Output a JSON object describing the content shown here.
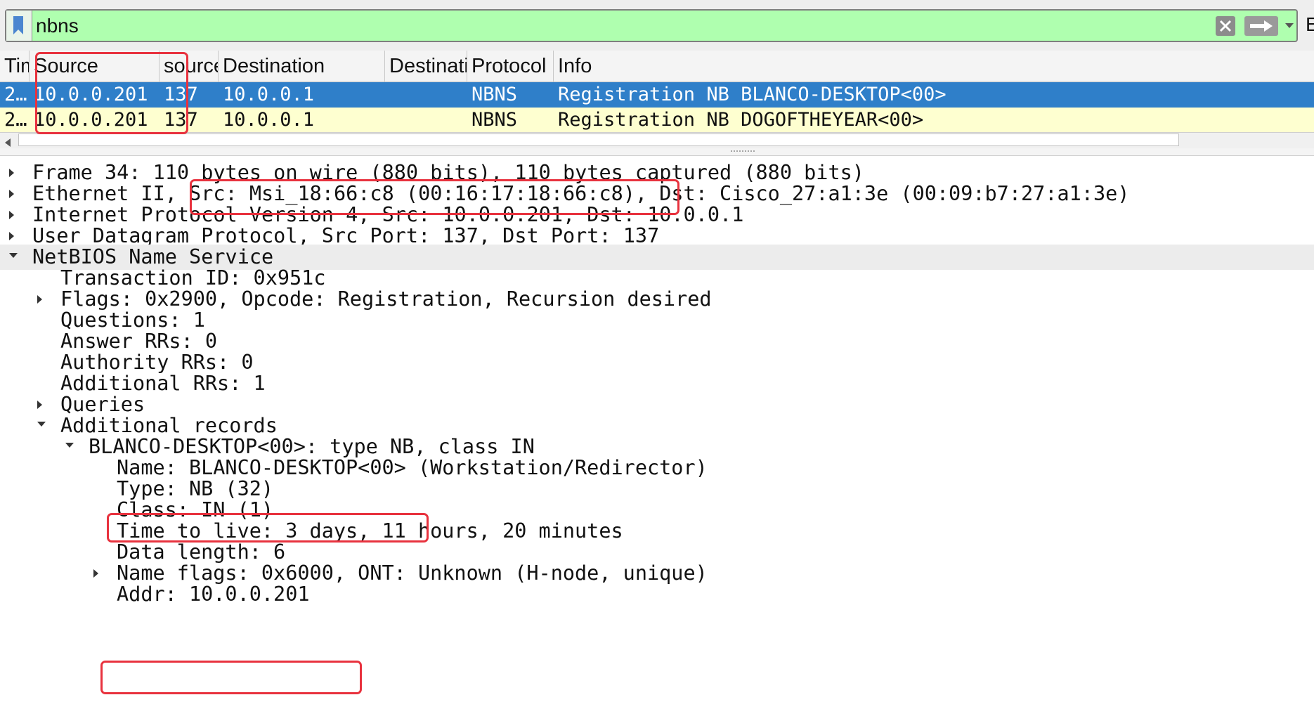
{
  "filter": {
    "value": "nbns",
    "expression_button_label": "E"
  },
  "packet_list": {
    "columns": [
      "Tim",
      "Source",
      "source",
      "Destination",
      "Destinatic",
      "Protocol",
      "Info"
    ],
    "rows": [
      {
        "time": "2…",
        "source": "10.0.0.201",
        "src_port": "137",
        "destination": "10.0.0.1",
        "dst_port": "",
        "protocol": "NBNS",
        "info": "Registration NB BLANCO-DESKTOP<00>",
        "selected": true
      },
      {
        "time": "2…",
        "source": "10.0.0.201",
        "src_port": "137",
        "destination": "10.0.0.1",
        "dst_port": "",
        "protocol": "NBNS",
        "info": "Registration NB DOGOFTHEYEAR<00>",
        "selected": false
      }
    ]
  },
  "details": {
    "frame": "Frame 34: 110 bytes on wire (880 bits), 110 bytes captured (880 bits)",
    "ethernet": "Ethernet II, Src: Msi_18:66:c8 (00:16:17:18:66:c8), Dst: Cisco_27:a1:3e (00:09:b7:27:a1:3e)",
    "ip": "Internet Protocol Version 4, Src: 10.0.0.201, Dst: 10.0.0.1",
    "udp": "User Datagram Protocol, Src Port: 137, Dst Port: 137",
    "nbns": "NetBIOS Name Service",
    "transaction_id": "Transaction ID: 0x951c",
    "flags": "Flags: 0x2900, Opcode: Registration, Recursion desired",
    "questions": "Questions: 1",
    "answer_rrs": "Answer RRs: 0",
    "authority_rrs": "Authority RRs: 0",
    "additional_rrs": "Additional RRs: 1",
    "queries": "Queries",
    "additional_records": "Additional records",
    "record": "BLANCO-DESKTOP<00>: type NB, class IN",
    "name": "Name: BLANCO-DESKTOP<00> (Workstation/Redirector)",
    "type": "Type: NB (32)",
    "class": "Class: IN (1)",
    "ttl": "Time to live: 3 days, 11 hours, 20 minutes",
    "data_length": "Data length: 6",
    "name_flags": "Name flags: 0x6000, ONT: Unknown (H-node, unique)",
    "addr": "Addr: 10.0.0.201"
  },
  "colors": {
    "filter_valid": "#afffaf",
    "selected_row": "#2f7fc9",
    "alt_row": "#feffd0",
    "annotation": "#e8323e"
  },
  "icons": [
    "bookmark-icon",
    "clear-icon",
    "apply-arrow-icon",
    "chevron-down-icon",
    "scroll-left-icon",
    "expand-icon",
    "collapse-icon"
  ]
}
